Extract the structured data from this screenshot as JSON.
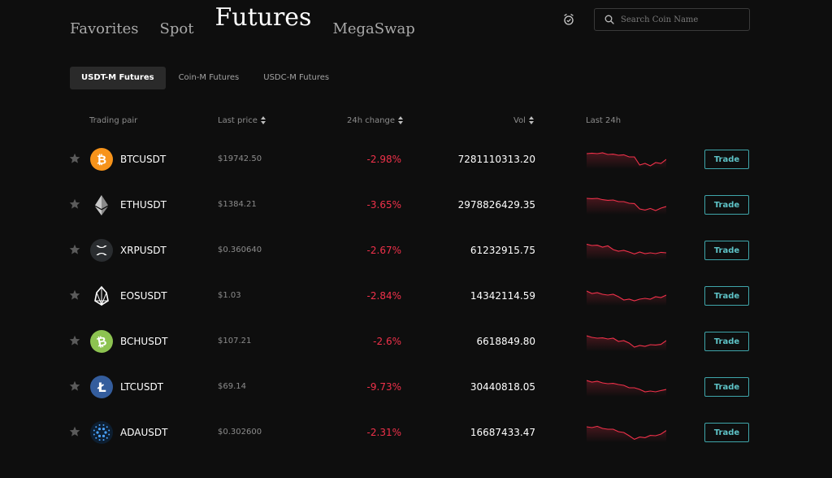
{
  "nav": {
    "tabs": [
      "Favorites",
      "Spot",
      "Futures",
      "MegaSwap"
    ],
    "active": 2
  },
  "search": {
    "placeholder": "Search Coin Name"
  },
  "sub_tabs": {
    "items": [
      "USDT-M Futures",
      "Coin-M Futures",
      "USDC-M Futures"
    ],
    "active": 0
  },
  "table": {
    "headers": {
      "pair": "Trading pair",
      "price": "Last price",
      "change": "24h change",
      "vol": "Vol",
      "spark": "Last 24h"
    },
    "trade_label": "Trade",
    "rows": [
      {
        "pair": "BTCUSDT",
        "price": "$19742.50",
        "change": "-2.98%",
        "vol": "7281110313.20",
        "icon": "btc-icon",
        "color": "#f7931a"
      },
      {
        "pair": "ETHUSDT",
        "price": "$1384.21",
        "change": "-3.65%",
        "vol": "2978826429.35",
        "icon": "eth-icon",
        "color": "#2a2a2a"
      },
      {
        "pair": "XRPUSDT",
        "price": "$0.360640",
        "change": "-2.67%",
        "vol": "61232915.75",
        "icon": "xrp-icon",
        "color": "#2a2d30"
      },
      {
        "pair": "EOSUSDT",
        "price": "$1.03",
        "change": "-2.84%",
        "vol": "14342114.59",
        "icon": "eos-icon",
        "color": "#000000"
      },
      {
        "pair": "BCHUSDT",
        "price": "$107.21",
        "change": "-2.6%",
        "vol": "6618849.80",
        "icon": "bch-icon",
        "color": "#8dc351"
      },
      {
        "pair": "LTCUSDT",
        "price": "$69.14",
        "change": "-9.73%",
        "vol": "30440818.05",
        "icon": "ltc-icon",
        "color": "#345d9d"
      },
      {
        "pair": "ADAUSDT",
        "price": "$0.302600",
        "change": "-2.31%",
        "vol": "16687433.47",
        "icon": "ada-icon",
        "color": "#0d1e30"
      }
    ]
  },
  "colors": {
    "negative": "#f0314a",
    "accent": "#3fa5aa",
    "background": "#0e0e0e"
  }
}
